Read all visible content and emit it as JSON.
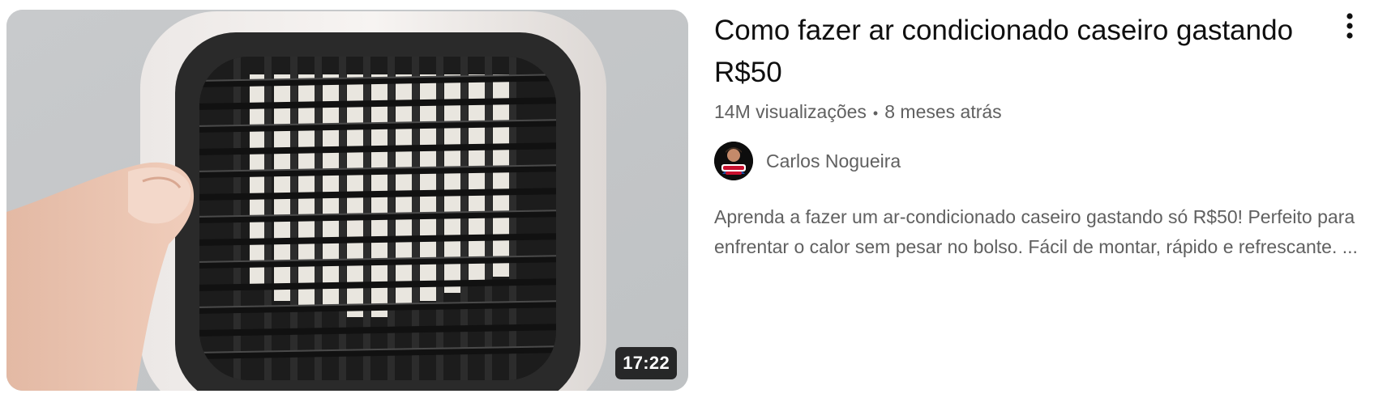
{
  "video": {
    "title": "Como fazer ar condicionado caseiro gastando R$50",
    "duration": "17:22",
    "views": "14M visualizações",
    "separator": "•",
    "published": "8 meses atrás",
    "description": "Aprenda a fazer um ar-condicionado caseiro gastando só R$50! Perfeito para enfrentar o calor sem pesar no bolso. Fácil de montar, rápido e refrescante. ...",
    "thumbnail_icon": "mini-air-cooler-photo"
  },
  "channel": {
    "name": "Carlos Nogueira",
    "avatar_icon": "channel-avatar-icon"
  },
  "menu": {
    "icon": "more-vert-icon"
  },
  "colors": {
    "title": "#0f0f0f",
    "secondary_text": "#606060",
    "duration_badge_bg": "#000000cc"
  }
}
